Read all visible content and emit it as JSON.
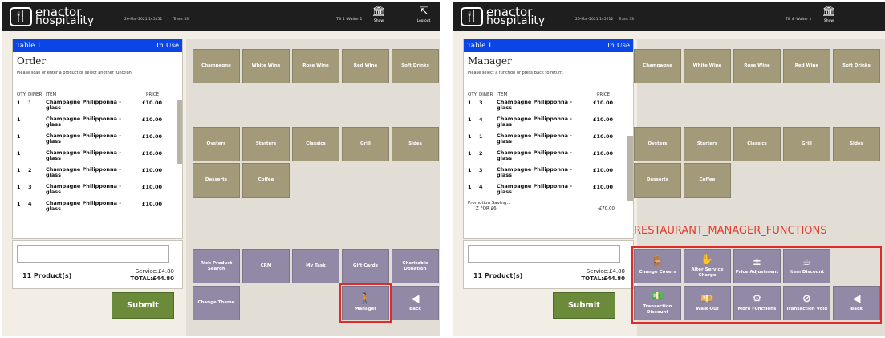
{
  "colors": {
    "header": "#1e1e1e",
    "panel": "#f2eee5",
    "blue_header": "#0b45e6",
    "product_btn": "#a39a7a",
    "function_btn": "#9189a5",
    "submit": "#6b8a3a",
    "highlight": "#e02b2b"
  },
  "common": {
    "brand_line1": "enactor",
    "brand_line2": "hospitality",
    "logo_icon": "restaurant-logo-icon",
    "till": "Till 4 -Waiter 1",
    "show_label": "Show",
    "logout_label": "Log out",
    "table": "Table 1",
    "status": "In Use",
    "col_qty": "QTY",
    "col_diner": "DINER",
    "col_item": "ITEM",
    "col_price": "PRICE",
    "product_count": "11 Product(s)",
    "service": "Service:£4.80",
    "total": "TOTAL:£44.80",
    "submit_label": "Submit",
    "product_buttons_row1": [
      "Champagne",
      "White Wine",
      "Rose Wine",
      "Red Wine",
      "Soft Drinks"
    ],
    "product_buttons_row2": [
      "Oysters",
      "Starters",
      "Classics",
      "Grill",
      "Sides"
    ],
    "product_buttons_row3": [
      "Desserts",
      "Coffee"
    ]
  },
  "left_panel": {
    "date": "26-Mar-2021 145151",
    "trans": "Trans 33",
    "title": "Order",
    "message": "Please scan or enter a product or select another function.",
    "items": [
      {
        "qty": "1",
        "diner": "1",
        "item": "Champagne Philipponna - glass",
        "price": "£10.00"
      },
      {
        "qty": "1",
        "diner": "",
        "item": "Champagne Philipponna - glass",
        "price": "£10.00"
      },
      {
        "qty": "1",
        "diner": "",
        "item": "Champagne Philipponna - glass",
        "price": "£10.00"
      },
      {
        "qty": "1",
        "diner": "",
        "item": "Champagne Philipponna - glass",
        "price": "£10.00"
      },
      {
        "qty": "1",
        "diner": "2",
        "item": "Champagne Philipponna - glass",
        "price": "£10.00"
      },
      {
        "qty": "1",
        "diner": "3",
        "item": "Champagne Philipponna - glass",
        "price": "£10.00"
      },
      {
        "qty": "1",
        "diner": "4",
        "item": "Champagne Philipponna - glass",
        "price": "£10.00"
      }
    ],
    "function_buttons": [
      "Rich Product Search",
      "CRM",
      "My Task",
      "Gift Cards",
      "Charitable Donation"
    ],
    "change_theme": "Change Theme",
    "manager": "Manager",
    "back": "Back"
  },
  "right_panel": {
    "date": "26-Mar-2021 145212",
    "trans": "Trans 33",
    "title": "Manager",
    "message": "Please select a function or press Back to return.",
    "items": [
      {
        "qty": "1",
        "diner": "3",
        "item": "Champagne Philipponna - glass",
        "price": "£10.00"
      },
      {
        "qty": "1",
        "diner": "4",
        "item": "Champagne Philipponna - glass",
        "price": "£10.00"
      },
      {
        "qty": "1",
        "diner": "1",
        "item": "Champagne Philipponna - glass",
        "price": "£10.00"
      },
      {
        "qty": "1",
        "diner": "2",
        "item": "Champagne Philipponna - glass",
        "price": "£10.00"
      },
      {
        "qty": "1",
        "diner": "3",
        "item": "Champagne Philipponna - glass",
        "price": "£10.00"
      },
      {
        "qty": "1",
        "diner": "4",
        "item": "Champagne Philipponna - glass",
        "price": "£10.00"
      }
    ],
    "promo_label": "Promotion Saving...",
    "promo_name": "Z FOR £6",
    "promo_value": "-£70.00",
    "section_label": "RESTAURANT_MANAGER_FUNCTIONS",
    "manager_buttons_row1": [
      "Change Covers",
      "Alter Service Charge",
      "Price Adjustment",
      "Item Discount"
    ],
    "manager_buttons_row2": [
      "Transaction Discount",
      "Walk Out",
      "More Functions",
      "Transaction Void"
    ],
    "back": "Back"
  }
}
